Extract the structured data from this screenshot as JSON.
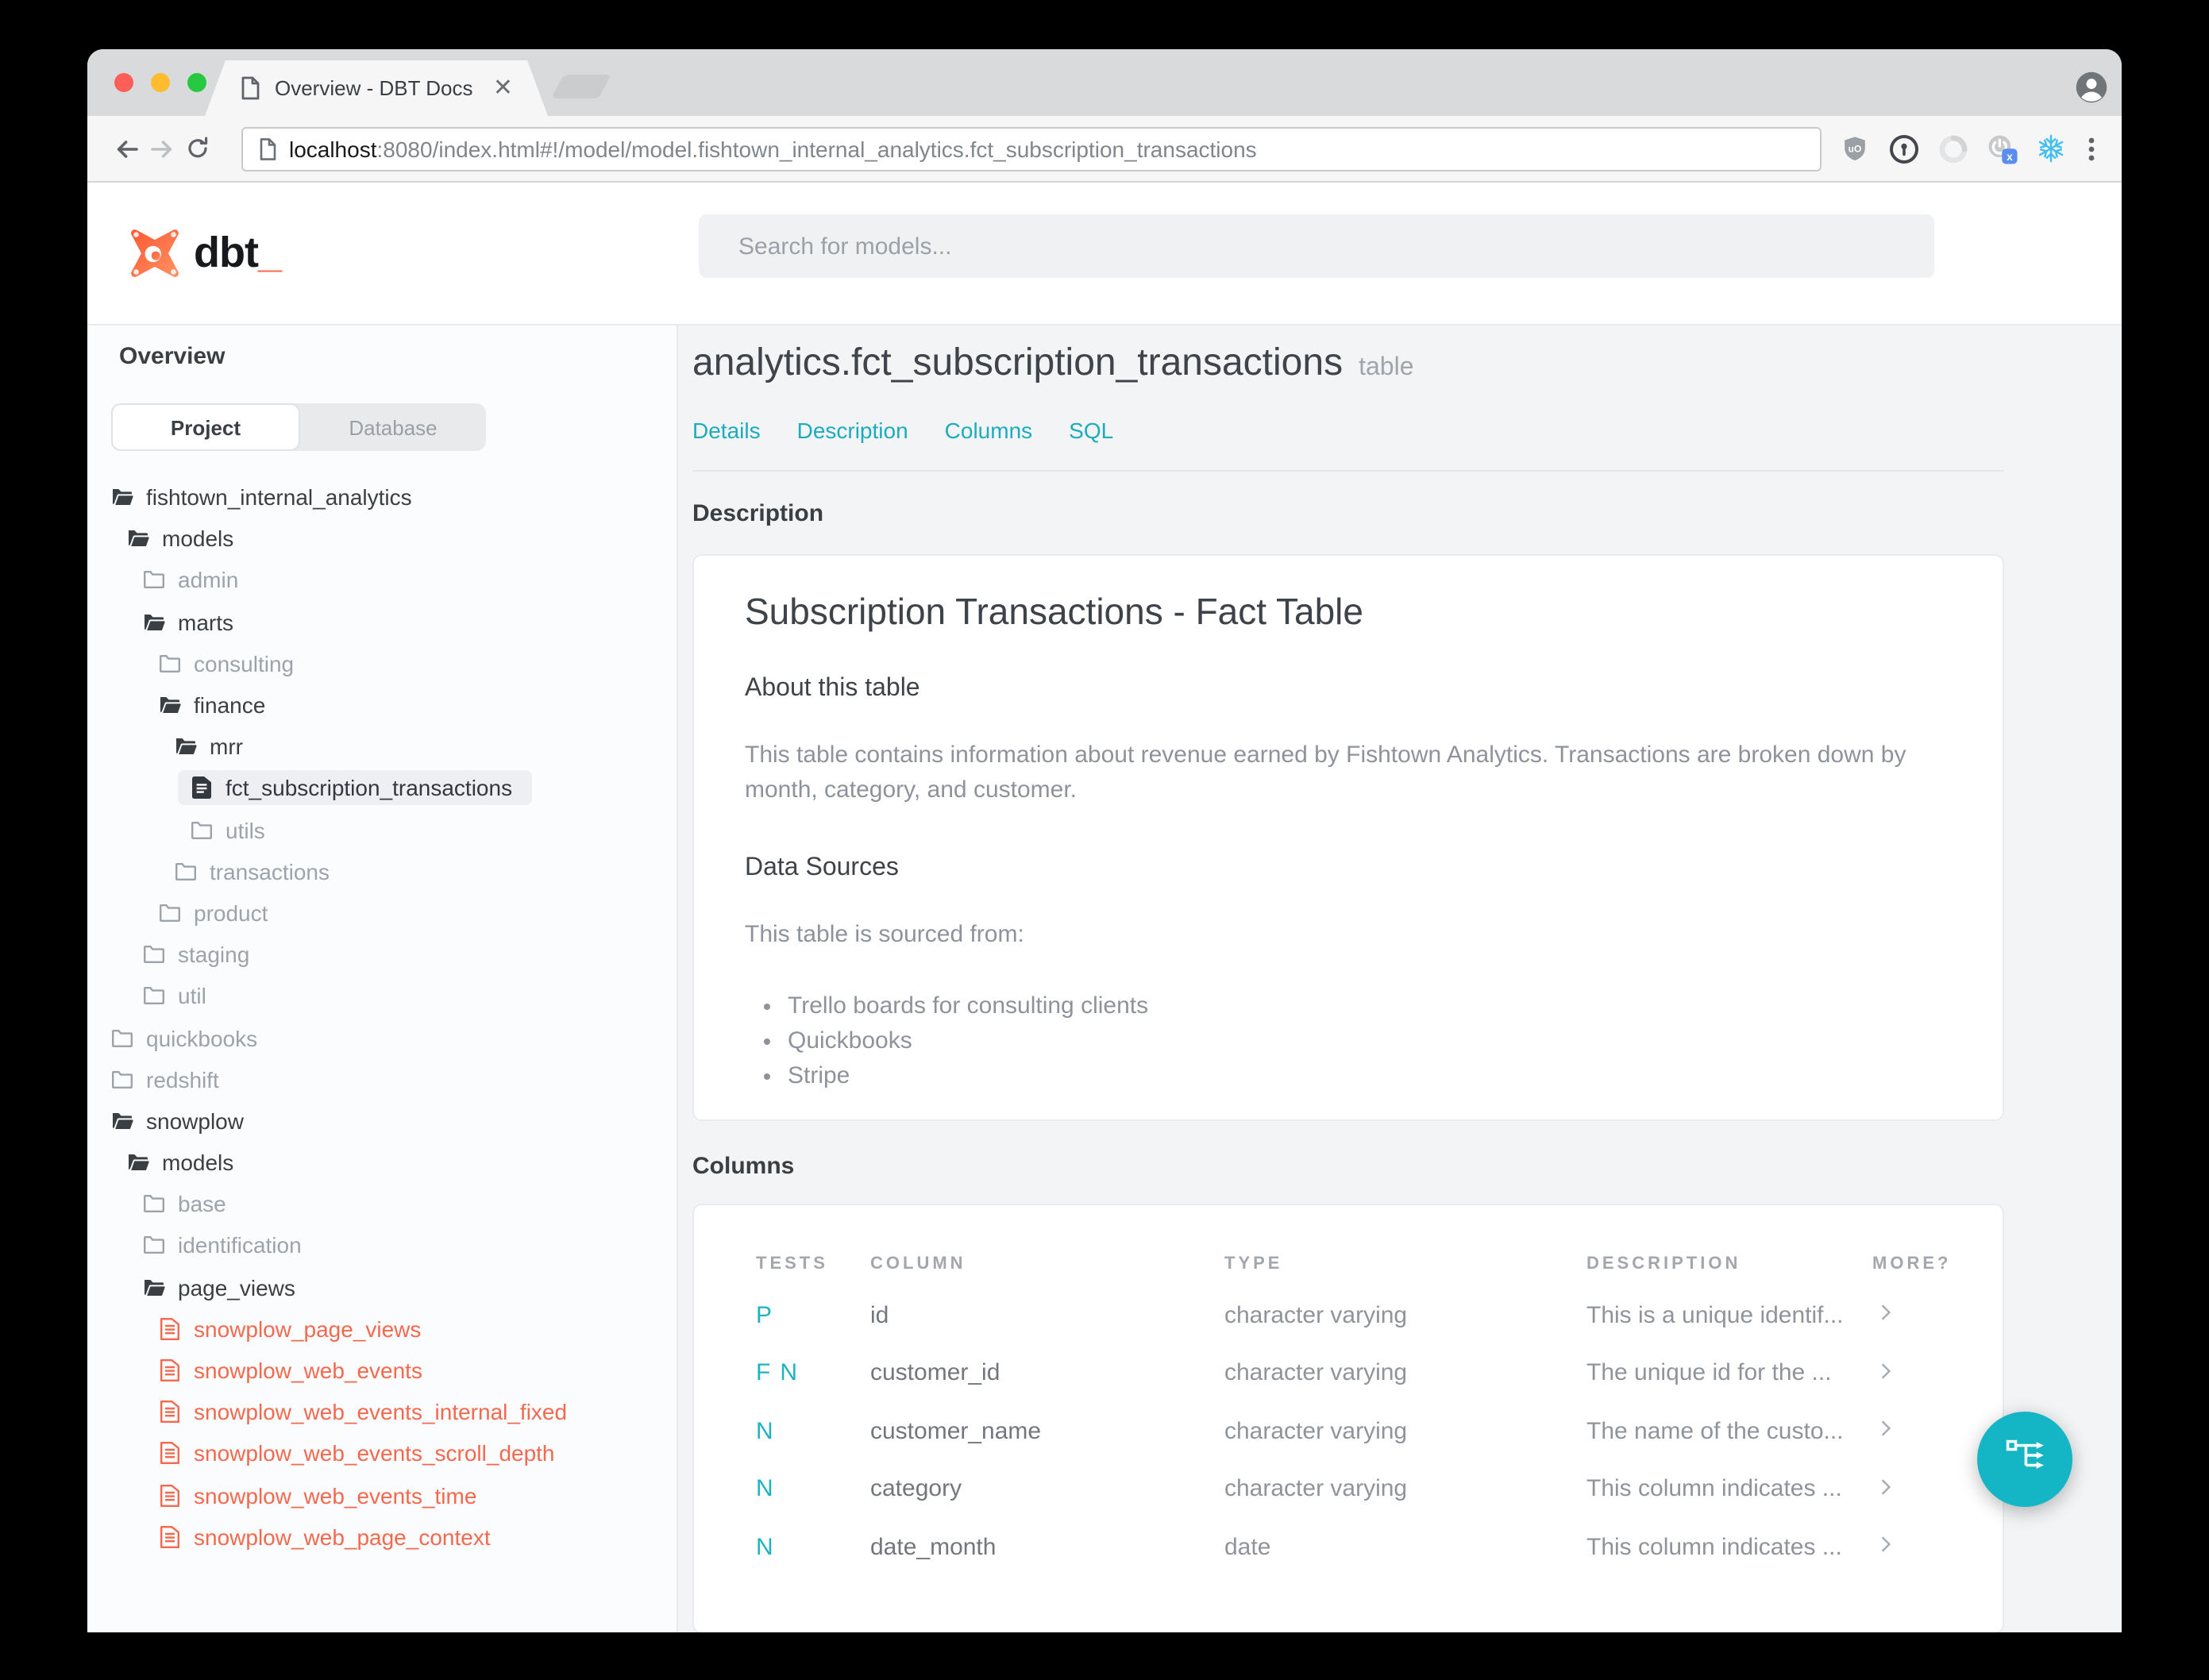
{
  "browser": {
    "tab_title": "Overview - DBT Docs",
    "url_host": "localhost",
    "url_rest": ":8080/index.html#!/model/model.fishtown_internal_analytics.fct_subscription_transactions",
    "extension_icons": [
      "ublock-shield-icon",
      "onepassword-icon",
      "extension-ring-icon",
      "session-x-icon",
      "snowflake-icon"
    ]
  },
  "header": {
    "logo_text": "dbt",
    "logo_underscore": "_",
    "search_placeholder": "Search for models..."
  },
  "sidebar": {
    "overview_label": "Overview",
    "tabs": [
      {
        "label": "Project",
        "active": true
      },
      {
        "label": "Database",
        "active": false
      }
    ],
    "tree": [
      {
        "label": "fishtown_internal_analytics",
        "level": 0,
        "icon": "folder-open-icon",
        "state": "normal"
      },
      {
        "label": "models",
        "level": 1,
        "icon": "folder-open-icon",
        "state": "normal"
      },
      {
        "label": "admin",
        "level": 2,
        "icon": "folder-icon",
        "state": "muted"
      },
      {
        "label": "marts",
        "level": 2,
        "icon": "folder-open-icon",
        "state": "normal"
      },
      {
        "label": "consulting",
        "level": 3,
        "icon": "folder-icon",
        "state": "muted"
      },
      {
        "label": "finance",
        "level": 3,
        "icon": "folder-open-icon",
        "state": "normal"
      },
      {
        "label": "mrr",
        "level": 4,
        "icon": "folder-open-icon",
        "state": "normal"
      },
      {
        "label": "fct_subscription_transactions",
        "level": 5,
        "icon": "file-icon",
        "state": "selected"
      },
      {
        "label": "utils",
        "level": 5,
        "icon": "folder-icon",
        "state": "muted"
      },
      {
        "label": "transactions",
        "level": 4,
        "icon": "folder-icon",
        "state": "muted"
      },
      {
        "label": "product",
        "level": 3,
        "icon": "folder-icon",
        "state": "muted"
      },
      {
        "label": "staging",
        "level": 2,
        "icon": "folder-icon",
        "state": "muted"
      },
      {
        "label": "util",
        "level": 2,
        "icon": "folder-icon",
        "state": "muted"
      },
      {
        "label": "quickbooks",
        "level": 0,
        "icon": "folder-icon",
        "state": "muted"
      },
      {
        "label": "redshift",
        "level": 0,
        "icon": "folder-icon",
        "state": "muted"
      },
      {
        "label": "snowplow",
        "level": 0,
        "icon": "folder-open-icon",
        "state": "normal"
      },
      {
        "label": "models",
        "level": 1,
        "icon": "folder-open-icon",
        "state": "normal"
      },
      {
        "label": "base",
        "level": 2,
        "icon": "folder-icon",
        "state": "muted"
      },
      {
        "label": "identification",
        "level": 2,
        "icon": "folder-icon",
        "state": "muted"
      },
      {
        "label": "page_views",
        "level": 2,
        "icon": "folder-open-icon",
        "state": "normal"
      },
      {
        "label": "snowplow_page_views",
        "level": 3,
        "icon": "file-outline-icon",
        "state": "error"
      },
      {
        "label": "snowplow_web_events",
        "level": 3,
        "icon": "file-outline-icon",
        "state": "error"
      },
      {
        "label": "snowplow_web_events_internal_fixed",
        "level": 3,
        "icon": "file-outline-icon",
        "state": "error"
      },
      {
        "label": "snowplow_web_events_scroll_depth",
        "level": 3,
        "icon": "file-outline-icon",
        "state": "error"
      },
      {
        "label": "snowplow_web_events_time",
        "level": 3,
        "icon": "file-outline-icon",
        "state": "error"
      },
      {
        "label": "snowplow_web_page_context",
        "level": 3,
        "icon": "file-outline-icon",
        "state": "error"
      }
    ]
  },
  "main": {
    "title": "analytics.fct_subscription_transactions",
    "title_suffix": "table",
    "nav": [
      "Details",
      "Description",
      "Columns",
      "SQL"
    ],
    "description_section": {
      "label": "Description",
      "heading": "Subscription Transactions - Fact Table",
      "about_heading": "About this table",
      "about_text": "This table contains information about revenue earned by Fishtown Analytics. Transactions are broken down by month, category, and customer.",
      "sources_heading": "Data Sources",
      "sources_intro": "This table is sourced from:",
      "sources": [
        "Trello boards for consulting clients",
        "Quickbooks",
        "Stripe"
      ]
    },
    "columns_section": {
      "label": "Columns",
      "table": {
        "headers": [
          "TESTS",
          "COLUMN",
          "TYPE",
          "DESCRIPTION",
          "MORE?"
        ],
        "rows": [
          {
            "tests": [
              "P"
            ],
            "column": "id",
            "type": "character varying",
            "description": "This is a unique identif..."
          },
          {
            "tests": [
              "F",
              "N"
            ],
            "column": "customer_id",
            "type": "character varying",
            "description": "The unique id for the ..."
          },
          {
            "tests": [
              "N"
            ],
            "column": "customer_name",
            "type": "character varying",
            "description": "The name of the custo..."
          },
          {
            "tests": [
              "N"
            ],
            "column": "category",
            "type": "character varying",
            "description": "This column indicates ..."
          },
          {
            "tests": [
              "N"
            ],
            "column": "date_month",
            "type": "date",
            "description": "This column indicates ..."
          }
        ]
      }
    }
  },
  "colors": {
    "accent_teal": "#14B5C5",
    "link_teal": "#1CACBE",
    "brand_orange": "#FF694B",
    "error_red": "#F4694E",
    "traffic_red": "#FF5F57",
    "traffic_yellow": "#FEBC2E",
    "traffic_green": "#28C840"
  }
}
